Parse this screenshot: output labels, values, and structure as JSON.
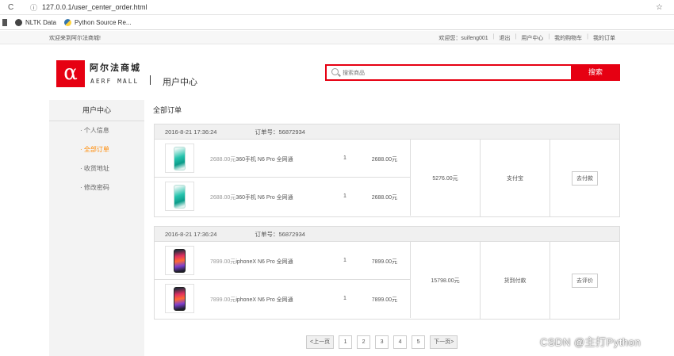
{
  "browser": {
    "url": "127.0.0.1/user_center_order.html",
    "bookmarks": [
      "NLTK Data",
      "Python Source Re..."
    ]
  },
  "site_top": {
    "welcome": "欢迎来到阿尔法商城!",
    "greeting": "欢迎您：suifeng001",
    "links": [
      "退出",
      "用户中心",
      "我的购物车",
      "我的订单"
    ]
  },
  "header": {
    "logo_symbol": "α",
    "logo_cn": "阿尔法商城",
    "logo_en": "AERF MALL",
    "section_title": "用户中心",
    "search_placeholder": "搜索商品",
    "search_button": "搜索"
  },
  "sidebar": {
    "title": "用户中心",
    "items": [
      {
        "label": "· 个人信息",
        "active": false
      },
      {
        "label": "· 全部订单",
        "active": true
      },
      {
        "label": "· 收货地址",
        "active": false
      },
      {
        "label": "· 修改密码",
        "active": false
      }
    ]
  },
  "main_title": "全部订单",
  "orders": [
    {
      "time": "2016-8-21 17:36:24",
      "order_no_label": "订单号：56872934",
      "goods": [
        {
          "price": "2688.00元",
          "name": "360手机 N6 Pro 全网通",
          "qty": "1",
          "subtotal": "2688.00元",
          "image": "n6"
        },
        {
          "price": "2688.00元",
          "name": "360手机 N6 Pro 全网通",
          "qty": "1",
          "subtotal": "2688.00元",
          "image": "n6"
        }
      ],
      "total": "5276.00元",
      "status": "支付宝",
      "action": "去付款"
    },
    {
      "time": "2016-8-21 17:36:24",
      "order_no_label": "订单号：56872934",
      "goods": [
        {
          "price": "7899.00元",
          "name": "iphoneX N6 Pro 全网通",
          "qty": "1",
          "subtotal": "7899.00元",
          "image": "x"
        },
        {
          "price": "7899.00元",
          "name": "iphoneX N6 Pro 全网通",
          "qty": "1",
          "subtotal": "7899.00元",
          "image": "x"
        }
      ],
      "total": "15798.00元",
      "status": "货到付款",
      "action": "去评价"
    }
  ],
  "pagination": {
    "prev": "<上一页",
    "pages": [
      "1",
      "2",
      "3",
      "4",
      "5"
    ],
    "next": "下一页>"
  },
  "watermark": "CSDN @主打Python",
  "colors": {
    "brand_red": "#e60012",
    "active_orange": "#ff8800"
  }
}
